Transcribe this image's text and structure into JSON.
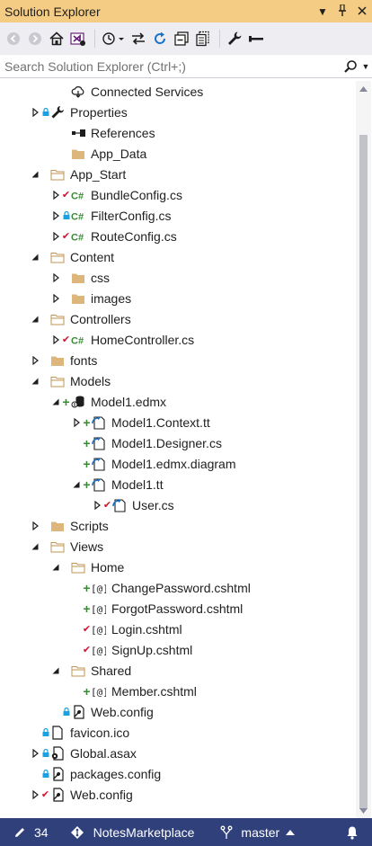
{
  "window": {
    "title": "Solution Explorer"
  },
  "search": {
    "placeholder": "Search Solution Explorer (Ctrl+;)"
  },
  "tree": [
    {
      "label": "Connected Services",
      "icon": "connected-services-icon",
      "depth": 1,
      "expander": "none",
      "status": "none"
    },
    {
      "label": "Properties",
      "icon": "wrench-icon",
      "depth": 0,
      "expander": "collapsed",
      "status": "lock"
    },
    {
      "label": "References",
      "icon": "references-icon",
      "depth": 1,
      "expander": "none",
      "status": "none"
    },
    {
      "label": "App_Data",
      "icon": "folder-icon",
      "depth": 1,
      "expander": "none",
      "status": "none"
    },
    {
      "label": "App_Start",
      "icon": "folder-open-icon",
      "depth": 0,
      "expander": "expanded",
      "status": "none"
    },
    {
      "label": "BundleConfig.cs",
      "icon": "csharp-file-icon",
      "depth": 1,
      "expander": "collapsed",
      "status": "checked-in"
    },
    {
      "label": "FilterConfig.cs",
      "icon": "csharp-file-icon",
      "depth": 1,
      "expander": "collapsed",
      "status": "lock"
    },
    {
      "label": "RouteConfig.cs",
      "icon": "csharp-file-icon",
      "depth": 1,
      "expander": "collapsed",
      "status": "checked-in"
    },
    {
      "label": "Content",
      "icon": "folder-open-icon",
      "depth": 0,
      "expander": "expanded",
      "status": "none"
    },
    {
      "label": "css",
      "icon": "folder-icon",
      "depth": 1,
      "expander": "collapsed",
      "status": "none"
    },
    {
      "label": "images",
      "icon": "folder-icon",
      "depth": 1,
      "expander": "collapsed",
      "status": "none"
    },
    {
      "label": "Controllers",
      "icon": "folder-open-icon",
      "depth": 0,
      "expander": "expanded",
      "status": "none"
    },
    {
      "label": "HomeController.cs",
      "icon": "csharp-file-icon",
      "depth": 1,
      "expander": "collapsed",
      "status": "checked-in"
    },
    {
      "label": "fonts",
      "icon": "folder-icon",
      "depth": 0,
      "expander": "collapsed",
      "status": "none"
    },
    {
      "label": "Models",
      "icon": "folder-open-icon",
      "depth": 0,
      "expander": "expanded",
      "status": "none"
    },
    {
      "label": "Model1.edmx",
      "icon": "edmx-icon",
      "depth": 1,
      "expander": "expanded",
      "status": "added"
    },
    {
      "label": "Model1.Context.tt",
      "icon": "tt-template-icon",
      "depth": 2,
      "expander": "collapsed",
      "status": "added"
    },
    {
      "label": "Model1.Designer.cs",
      "icon": "tt-template-icon",
      "depth": 2,
      "expander": "none",
      "status": "added"
    },
    {
      "label": "Model1.edmx.diagram",
      "icon": "tt-template-icon",
      "depth": 2,
      "expander": "none",
      "status": "added"
    },
    {
      "label": "Model1.tt",
      "icon": "tt-template-icon",
      "depth": 2,
      "expander": "expanded",
      "status": "added"
    },
    {
      "label": "User.cs",
      "icon": "tt-template-icon",
      "depth": 3,
      "expander": "collapsed",
      "status": "checked-in"
    },
    {
      "label": "Scripts",
      "icon": "folder-icon",
      "depth": 0,
      "expander": "collapsed",
      "status": "none"
    },
    {
      "label": "Views",
      "icon": "folder-open-icon",
      "depth": 0,
      "expander": "expanded",
      "status": "none"
    },
    {
      "label": "Home",
      "icon": "folder-open-icon",
      "depth": 1,
      "expander": "expanded",
      "status": "none"
    },
    {
      "label": "ChangePassword.cshtml",
      "icon": "razor-file-icon",
      "depth": 2,
      "expander": "none",
      "status": "added"
    },
    {
      "label": "ForgotPassword.cshtml",
      "icon": "razor-file-icon",
      "depth": 2,
      "expander": "none",
      "status": "added"
    },
    {
      "label": "Login.cshtml",
      "icon": "razor-file-icon",
      "depth": 2,
      "expander": "none",
      "status": "checked-in"
    },
    {
      "label": "SignUp.cshtml",
      "icon": "razor-file-icon",
      "depth": 2,
      "expander": "none",
      "status": "checked-in"
    },
    {
      "label": "Shared",
      "icon": "folder-open-icon",
      "depth": 1,
      "expander": "expanded",
      "status": "none"
    },
    {
      "label": "Member.cshtml",
      "icon": "razor-file-icon",
      "depth": 2,
      "expander": "none",
      "status": "added"
    },
    {
      "label": "Web.config",
      "icon": "config-file-icon",
      "depth": 1,
      "expander": "none",
      "status": "lock"
    },
    {
      "label": "favicon.ico",
      "icon": "file-icon",
      "depth": 0,
      "expander": "none",
      "status": "lock"
    },
    {
      "label": "Global.asax",
      "icon": "global-asax-icon",
      "depth": 0,
      "expander": "collapsed",
      "status": "lock"
    },
    {
      "label": "packages.config",
      "icon": "config-file-icon",
      "depth": 0,
      "expander": "none",
      "status": "lock"
    },
    {
      "label": "Web.config",
      "icon": "config-file-icon",
      "depth": 0,
      "expander": "collapsed",
      "status": "checked-in"
    }
  ],
  "statusbar": {
    "changes": "34",
    "repo": "NotesMarketplace",
    "branch": "master"
  },
  "colors": {
    "titlebar": "#f5cc84",
    "toolbar": "#eeeef2",
    "statusbar": "#30407a",
    "folder": "#dcb67a",
    "csharp": "#388a34",
    "checked_in": "#d1142e",
    "lock": "#1ba1e2"
  }
}
